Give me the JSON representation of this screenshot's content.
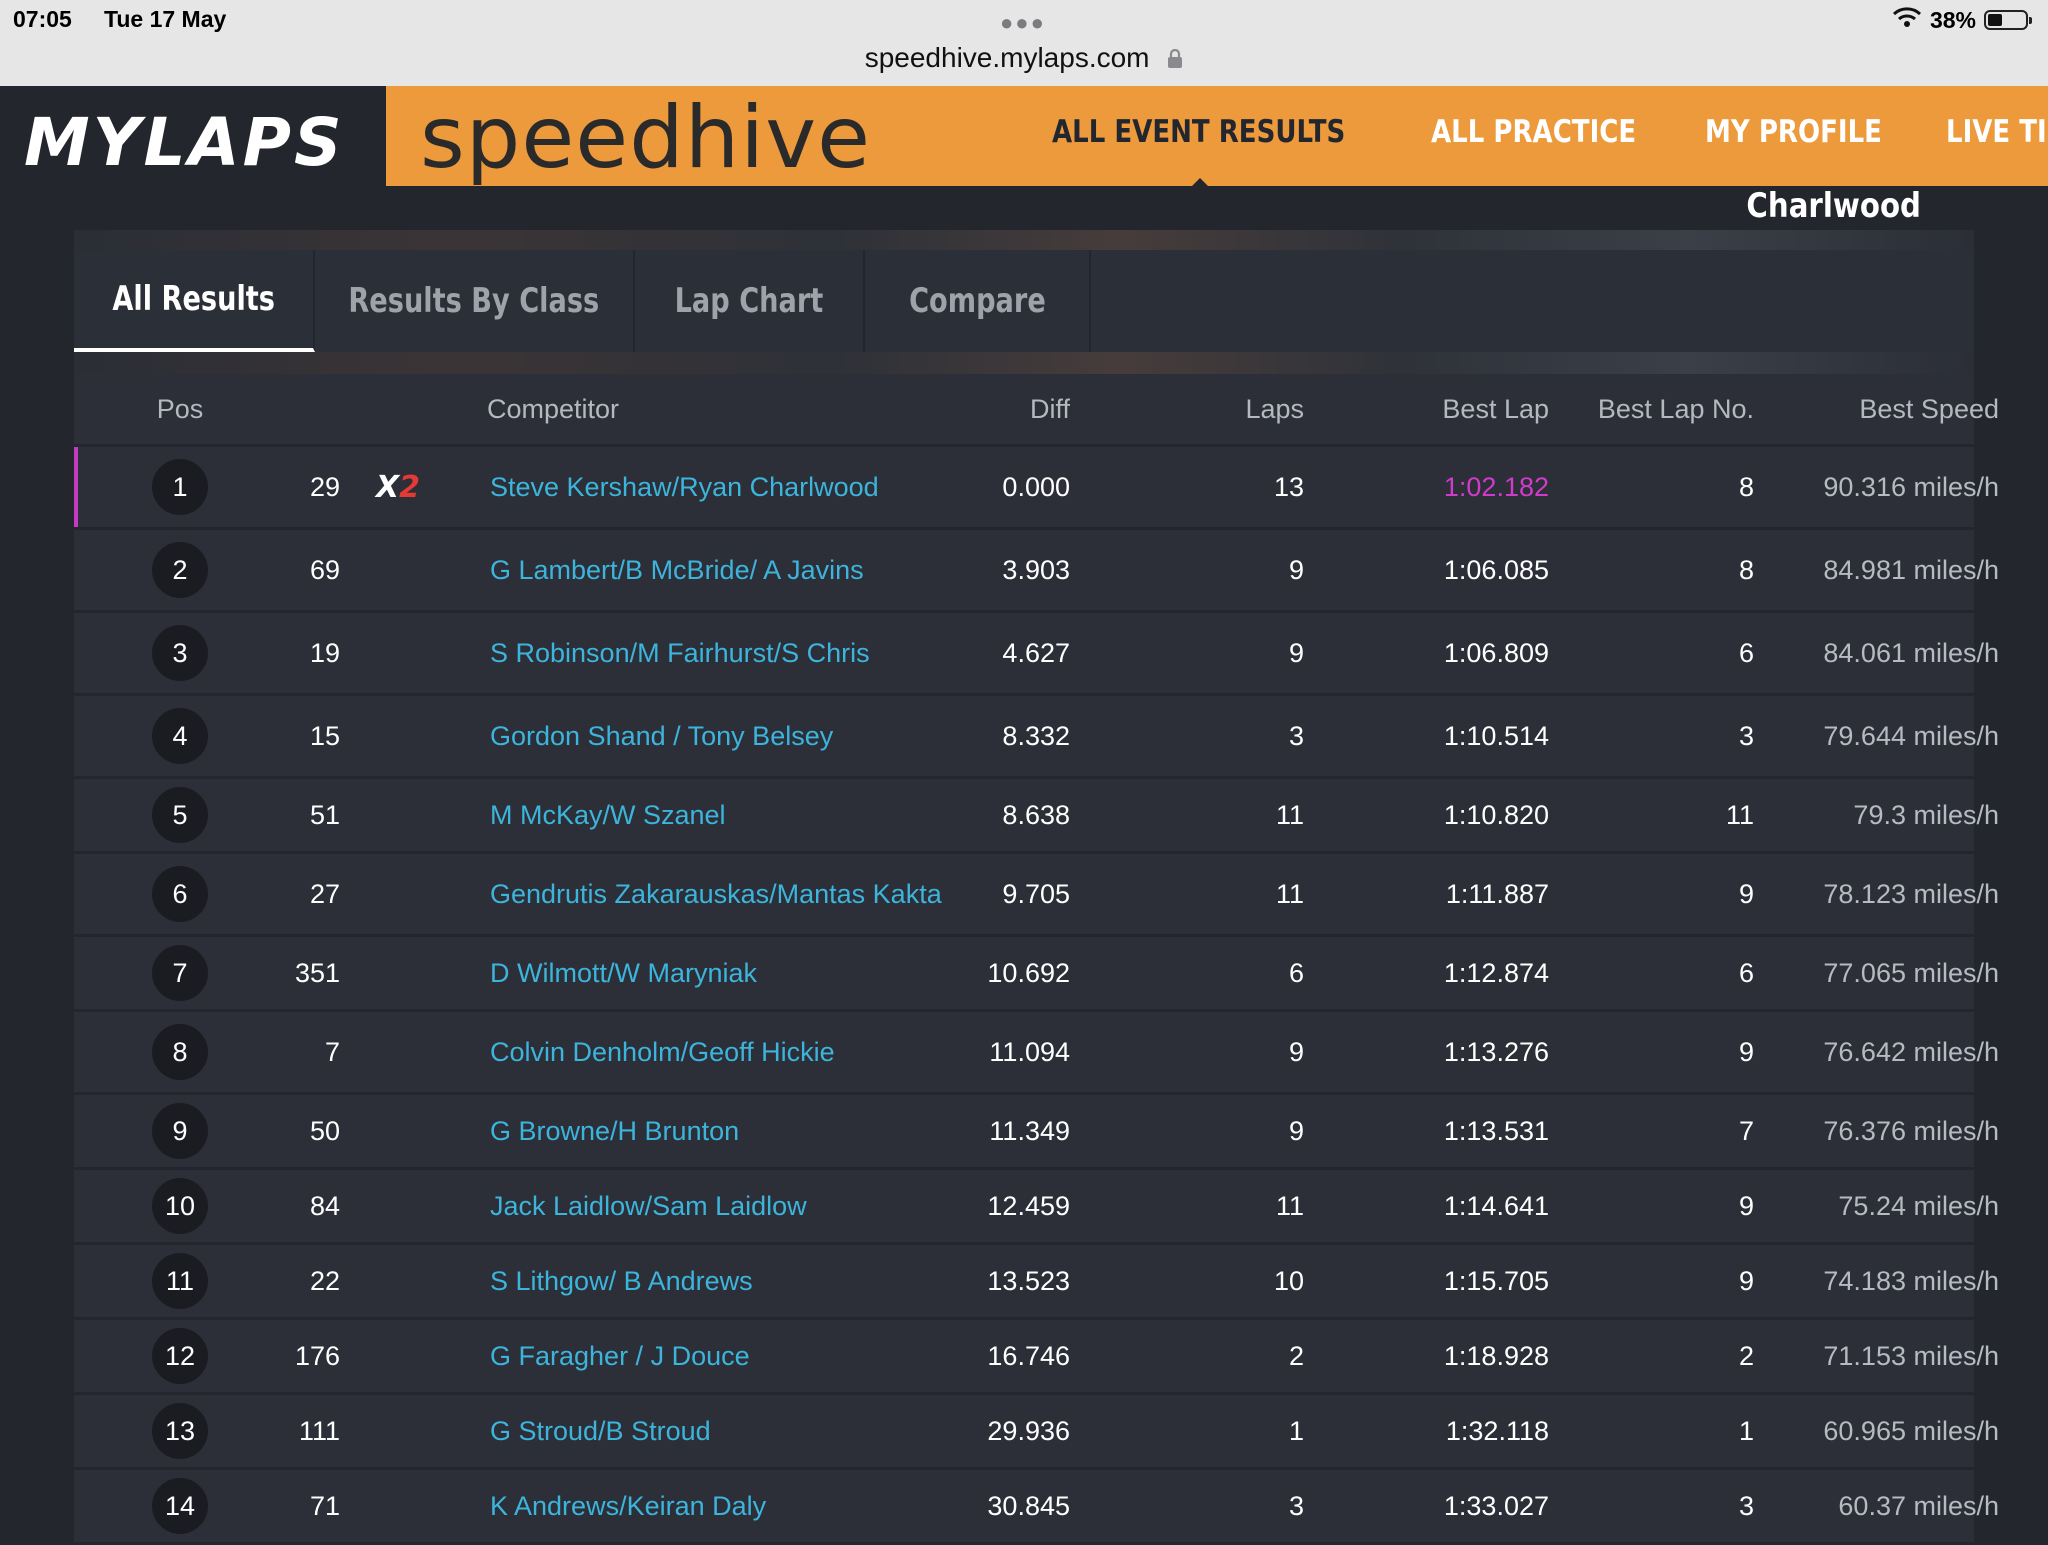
{
  "status_bar": {
    "time": "07:05",
    "date": "Tue 17 May",
    "url": "speedhive.mylaps.com",
    "battery": "38%",
    "battery_level": 0.38
  },
  "header": {
    "logo": "MYLAPS",
    "brand": "speedhive",
    "nav": [
      "ALL EVENT RESULTS",
      "ALL PRACTICE",
      "MY PROFILE",
      "LIVE TIMING"
    ],
    "active_nav": "ALL EVENT RESULTS",
    "accent_color": "#ec9a3c"
  },
  "venue": "Charlwood",
  "tabs": [
    "All Results",
    "Results By Class",
    "Lap Chart",
    "Compare"
  ],
  "active_tab": "All Results",
  "table": {
    "columns": [
      "Pos",
      "Competitor",
      "Diff",
      "Laps",
      "Best Lap",
      "Best Lap No.",
      "Best Speed"
    ],
    "rows": [
      {
        "pos": "1",
        "num": "29",
        "badge": "X2",
        "competitor": "Steve Kershaw/Ryan Charlwood",
        "diff": "0.000",
        "laps": "13",
        "best_lap": "1:02.182",
        "best_lap_no": "8",
        "best_speed": "90.316 miles/h"
      },
      {
        "pos": "2",
        "num": "69",
        "competitor": "G Lambert/B McBride/ A Javins",
        "diff": "3.903",
        "laps": "9",
        "best_lap": "1:06.085",
        "best_lap_no": "8",
        "best_speed": "84.981 miles/h"
      },
      {
        "pos": "3",
        "num": "19",
        "competitor": "S Robinson/M Fairhurst/S Chris",
        "diff": "4.627",
        "laps": "9",
        "best_lap": "1:06.809",
        "best_lap_no": "6",
        "best_speed": "84.061 miles/h"
      },
      {
        "pos": "4",
        "num": "15",
        "competitor": "Gordon Shand / Tony Belsey",
        "diff": "8.332",
        "laps": "3",
        "best_lap": "1:10.514",
        "best_lap_no": "3",
        "best_speed": "79.644 miles/h"
      },
      {
        "pos": "5",
        "num": "51",
        "competitor": "M McKay/W Szanel",
        "diff": "8.638",
        "laps": "11",
        "best_lap": "1:10.820",
        "best_lap_no": "11",
        "best_speed": "79.3 miles/h"
      },
      {
        "pos": "6",
        "num": "27",
        "competitor": "Gendrutis Zakarauskas/Mantas Kakta",
        "diff": "9.705",
        "laps": "11",
        "best_lap": "1:11.887",
        "best_lap_no": "9",
        "best_speed": "78.123 miles/h"
      },
      {
        "pos": "7",
        "num": "351",
        "competitor": "D Wilmott/W Maryniak",
        "diff": "10.692",
        "laps": "6",
        "best_lap": "1:12.874",
        "best_lap_no": "6",
        "best_speed": "77.065 miles/h"
      },
      {
        "pos": "8",
        "num": "7",
        "competitor": "Colvin Denholm/Geoff Hickie",
        "diff": "11.094",
        "laps": "9",
        "best_lap": "1:13.276",
        "best_lap_no": "9",
        "best_speed": "76.642 miles/h"
      },
      {
        "pos": "9",
        "num": "50",
        "competitor": "G Browne/H Brunton",
        "diff": "11.349",
        "laps": "9",
        "best_lap": "1:13.531",
        "best_lap_no": "7",
        "best_speed": "76.376 miles/h"
      },
      {
        "pos": "10",
        "num": "84",
        "competitor": "Jack Laidlow/Sam Laidlow",
        "diff": "12.459",
        "laps": "11",
        "best_lap": "1:14.641",
        "best_lap_no": "9",
        "best_speed": "75.24 miles/h"
      },
      {
        "pos": "11",
        "num": "22",
        "competitor": "S Lithgow/ B Andrews",
        "diff": "13.523",
        "laps": "10",
        "best_lap": "1:15.705",
        "best_lap_no": "9",
        "best_speed": "74.183 miles/h"
      },
      {
        "pos": "12",
        "num": "176",
        "competitor": "G Faragher / J Douce",
        "diff": "16.746",
        "laps": "2",
        "best_lap": "1:18.928",
        "best_lap_no": "2",
        "best_speed": "71.153 miles/h"
      },
      {
        "pos": "13",
        "num": "111",
        "competitor": "G Stroud/B Stroud",
        "diff": "29.936",
        "laps": "1",
        "best_lap": "1:32.118",
        "best_lap_no": "1",
        "best_speed": "60.965 miles/h"
      },
      {
        "pos": "14",
        "num": "71",
        "competitor": "K Andrews/Keiran Daly",
        "diff": "30.845",
        "laps": "3",
        "best_lap": "1:33.027",
        "best_lap_no": "3",
        "best_speed": "60.37 miles/h"
      }
    ]
  }
}
